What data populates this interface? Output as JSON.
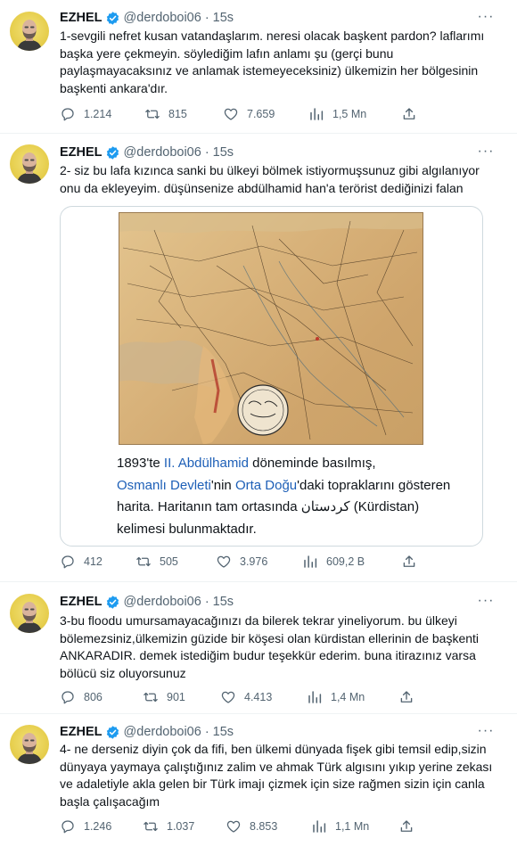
{
  "accent_color": "#1d9bf0",
  "tweets": [
    {
      "name": "EZHEL",
      "handle": "@derdoboi06",
      "time": "15s",
      "text": "1-sevgili nefret kusan vatandaşlarım. neresi olacak başkent pardon? laflarımı başka yere çekmeyin. söylediğim lafın anlamı şu (gerçi bunu paylaşmayacaksınız ve anlamak istemeyeceksiniz) ülkemizin her bölgesinin başkenti ankara'dır.",
      "replies": "1.214",
      "retweets": "815",
      "likes": "7.659",
      "views": "1,5 Mn"
    },
    {
      "name": "EZHEL",
      "handle": "@derdoboi06",
      "time": "15s",
      "text": "2- siz bu lafa kızınca sanki bu ülkeyi bölmek istiyormuşsunuz gibi algılanıyor onu da ekleyeyim. düşünsenize abdülhamid han'a terörist dediğinizi falan",
      "card": {
        "p1": "1893'te ",
        "link1": "II. Abdülhamid",
        "p2": " döneminde basılmış,",
        "link2": "Osmanlı Devleti",
        "p3": "'nin ",
        "link3": "Orta Doğu",
        "p4": "'daki topraklarını gösteren harita. Haritanın tam ortasında كردستان (Kürdistan) kelimesi bulunmaktadır."
      },
      "replies": "412",
      "retweets": "505",
      "likes": "3.976",
      "views": "609,2 B"
    },
    {
      "name": "EZHEL",
      "handle": "@derdoboi06",
      "time": "15s",
      "text": "3-bu floodu umursamayacağınızı da bilerek tekrar yineliyorum. bu ülkeyi bölemezsiniz,ülkemizin güzide bir köşesi olan kürdistan ellerinin de başkenti ANKARADIR. demek istediğim budur teşekkür ederim. buna itirazınız varsa bölücü siz oluyorsunuz",
      "replies": "806",
      "retweets": "901",
      "likes": "4.413",
      "views": "1,4 Mn"
    },
    {
      "name": "EZHEL",
      "handle": "@derdoboi06",
      "time": "15s",
      "text": "4- ne derseniz diyin çok da fifi, ben ülkemi dünyada fişek gibi temsil edip,sizin dünyaya yaymaya çalıştığınız zalim ve ahmak Türk algısını yıkıp yerine zekası ve adaletiyle akla gelen bir Türk imajı çizmek için size rağmen sizin için canla başla çalışacağım",
      "replies": "1.246",
      "retweets": "1.037",
      "likes": "8.853",
      "views": "1,1 Mn"
    }
  ]
}
